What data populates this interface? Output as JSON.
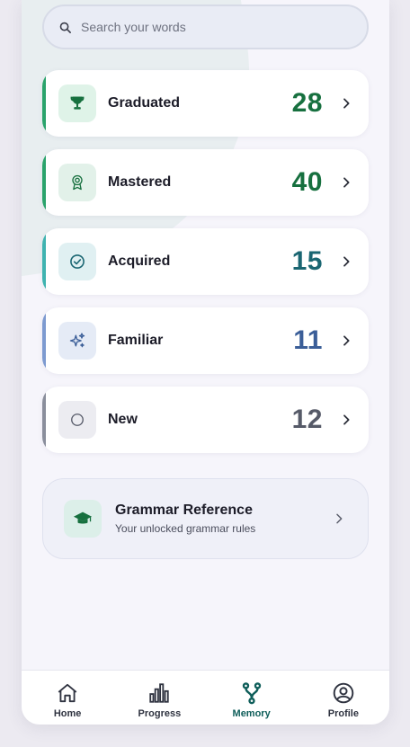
{
  "search": {
    "placeholder": "Search your words"
  },
  "categories": [
    {
      "label": "Graduated",
      "count": "28",
      "icon": "trophy-icon",
      "color": "#17703f",
      "bar": "#2aa36b",
      "icon_bg": "#dff3e8"
    },
    {
      "label": "Mastered",
      "count": "40",
      "icon": "award-icon",
      "color": "#17703f",
      "bar": "#2aa36b",
      "icon_bg": "#e2f1e9"
    },
    {
      "label": "Acquired",
      "count": "15",
      "icon": "check-circle-icon",
      "color": "#1a6672",
      "bar": "#3fb3b0",
      "icon_bg": "#e0f0f2"
    },
    {
      "label": "Familiar",
      "count": "11",
      "icon": "sparkles-icon",
      "color": "#3b5e98",
      "bar": "#7d9ad0",
      "icon_bg": "#e5ebf6"
    },
    {
      "label": "New",
      "count": "12",
      "icon": "circle-icon",
      "color": "#565a68",
      "bar": "#8a8e9c",
      "icon_bg": "#ececf1"
    }
  ],
  "grammar": {
    "title": "Grammar Reference",
    "subtitle": "Your unlocked grammar rules",
    "icon": "graduation-cap-icon"
  },
  "nav": {
    "tabs": [
      {
        "label": "Home",
        "icon": "home-icon"
      },
      {
        "label": "Progress",
        "icon": "bar-chart-icon"
      },
      {
        "label": "Memory",
        "icon": "memory-branch-icon",
        "active": true
      },
      {
        "label": "Profile",
        "icon": "profile-icon"
      }
    ]
  },
  "colors": {
    "accent": "#0f5e5a",
    "background": "#f6f5fb"
  }
}
